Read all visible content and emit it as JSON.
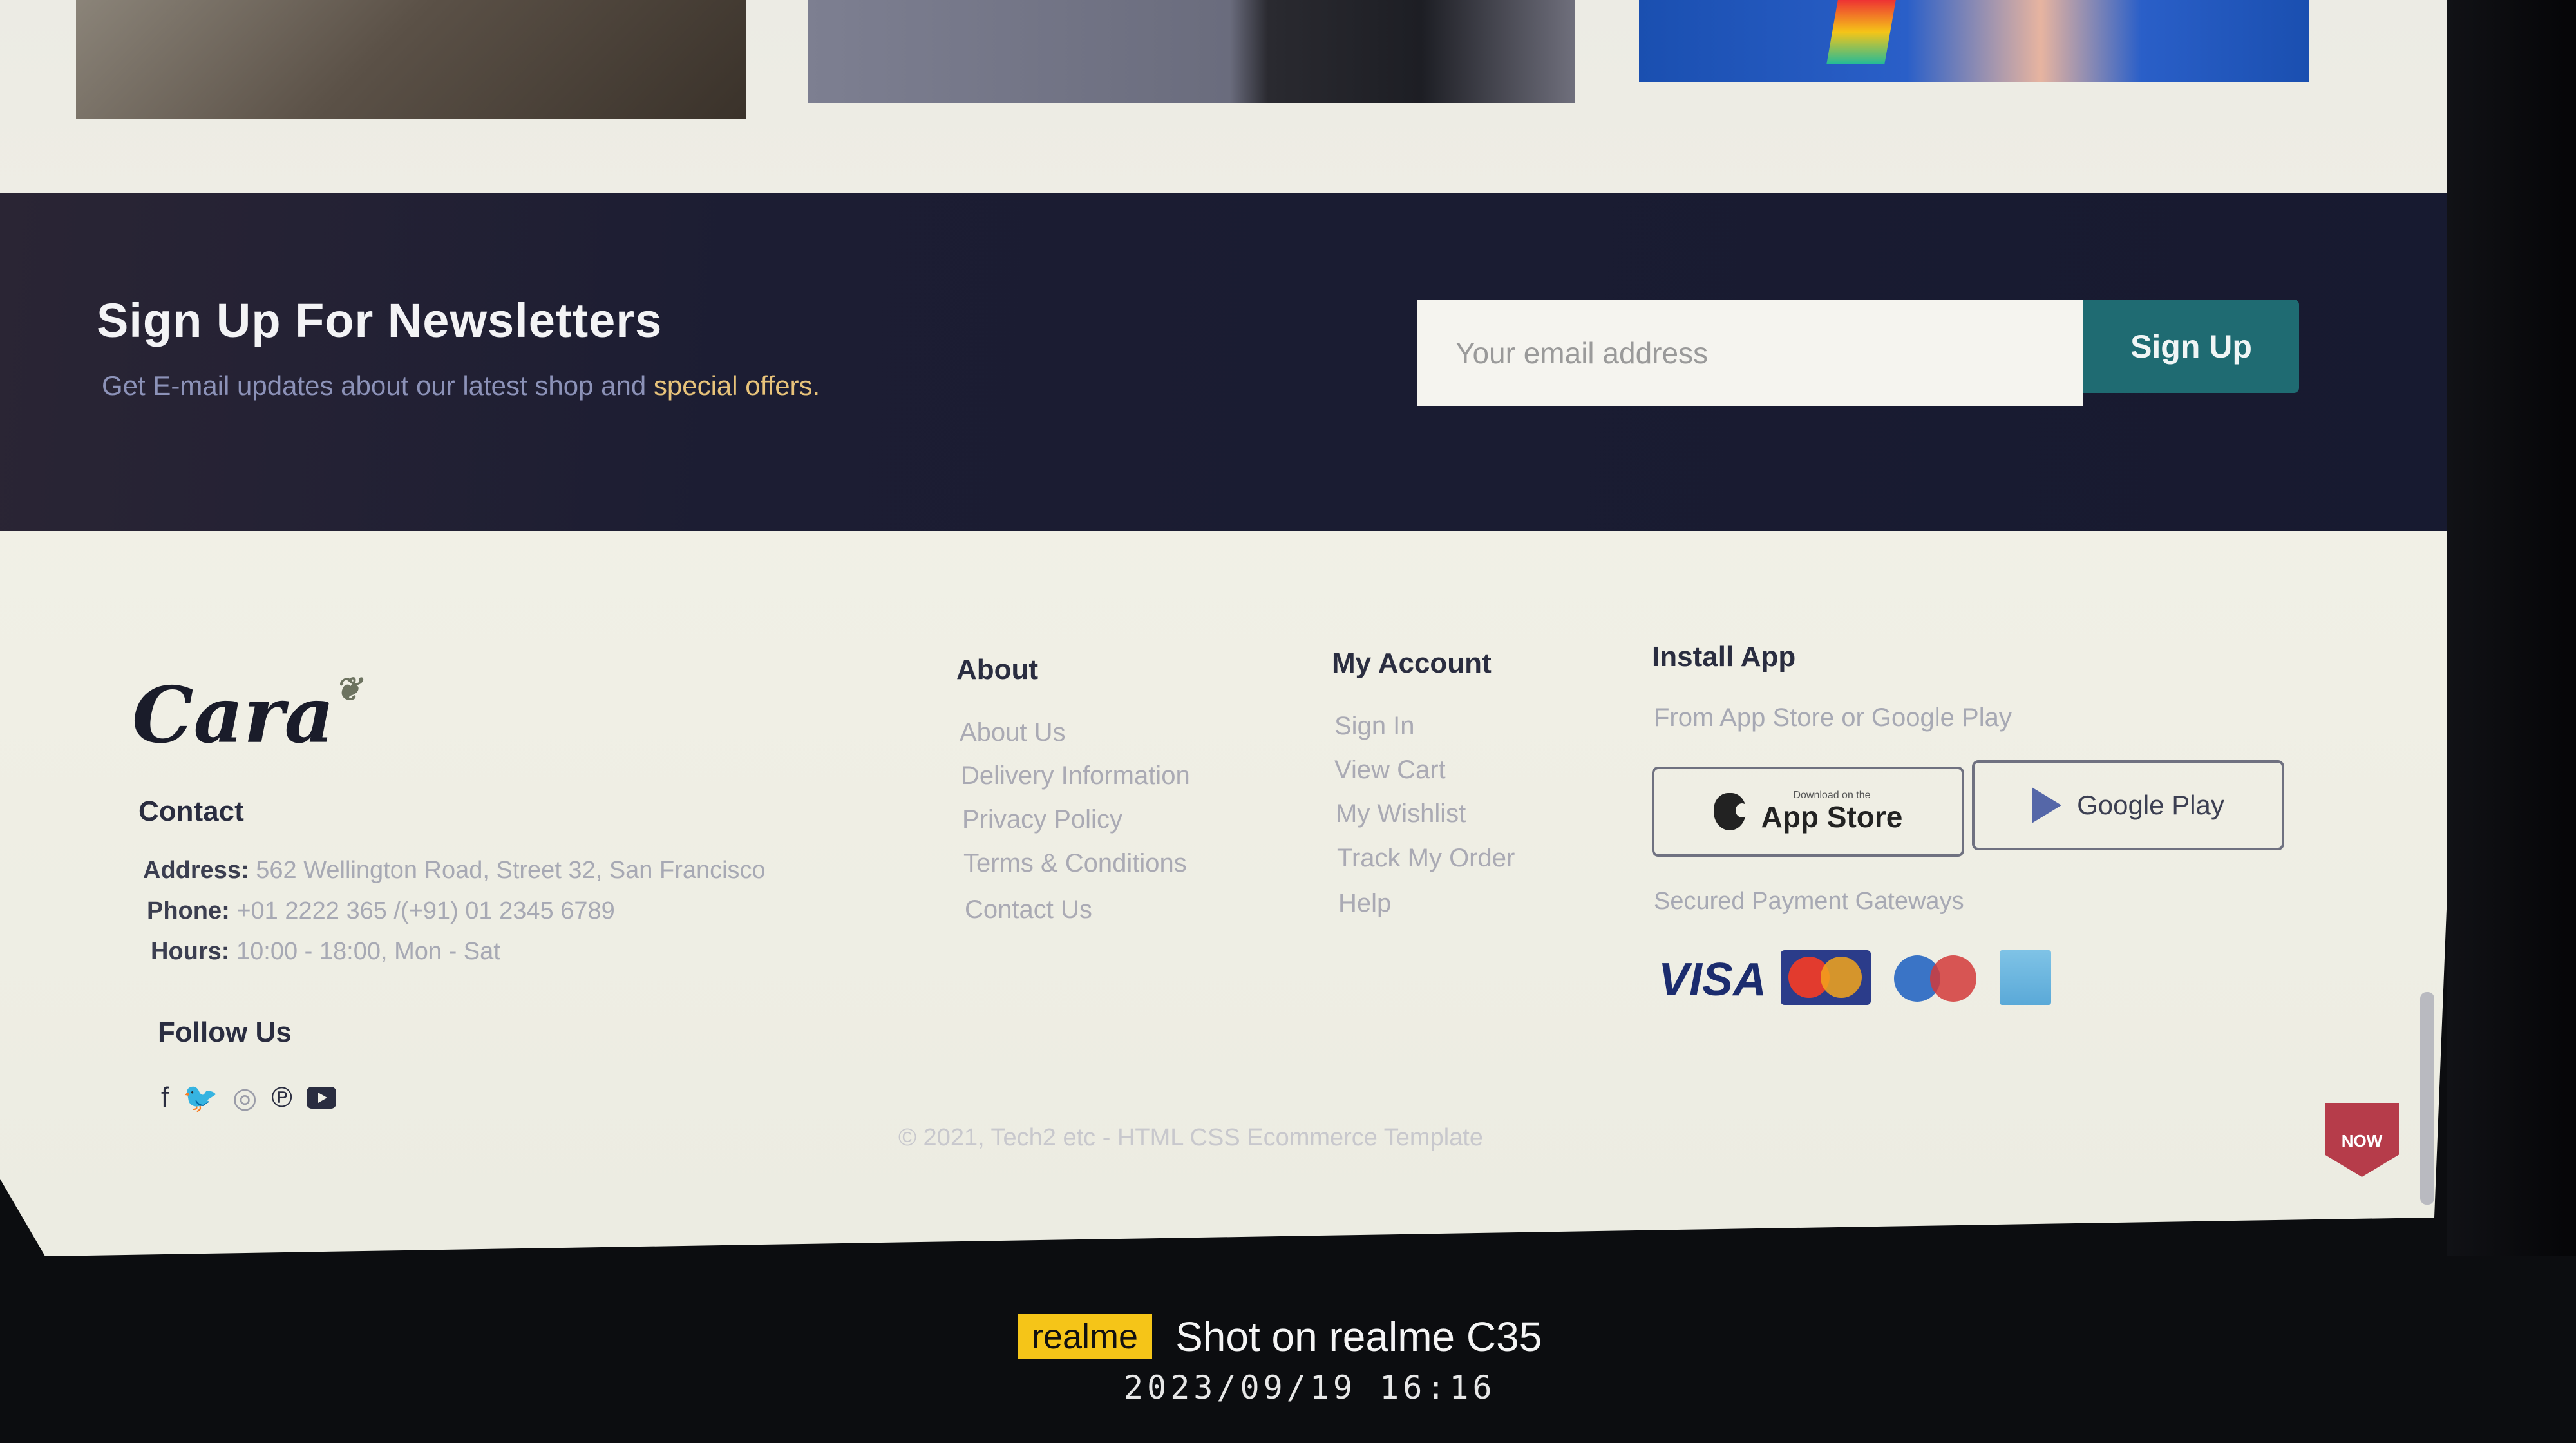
{
  "newsletter": {
    "title": "Sign Up For Newsletters",
    "subtitle_before": "Get E-mail updates about our latest shop and ",
    "subtitle_highlight": "special offers.",
    "email_placeholder": "Your email address",
    "signup_label": "Sign Up"
  },
  "brand": {
    "logo_text": "Cara"
  },
  "contact": {
    "heading": "Contact",
    "address_label": "Address:",
    "address_value": "562 Wellington Road, Street 32, San Francisco",
    "phone_label": "Phone:",
    "phone_value": "+01 2222 365 /(+91) 01 2345 6789",
    "hours_label": "Hours:",
    "hours_value": "10:00 - 18:00, Mon - Sat",
    "follow_heading": "Follow Us",
    "social_icons": [
      "facebook-icon",
      "twitter-icon",
      "instagram-icon",
      "pinterest-icon",
      "youtube-icon"
    ]
  },
  "about": {
    "heading": "About",
    "links": [
      "About Us",
      "Delivery Information",
      "Privacy Policy",
      "Terms & Conditions",
      "Contact Us"
    ]
  },
  "account": {
    "heading": "My Account",
    "links": [
      "Sign In",
      "View Cart",
      "My Wishlist",
      "Track My Order",
      "Help"
    ]
  },
  "install": {
    "heading": "Install App",
    "subtitle": "From App Store or Google Play",
    "appstore_small": "Download on the",
    "appstore_big": "App Store",
    "googleplay": "Google Play",
    "payments_heading": "Secured Payment Gateways",
    "visa": "VISA"
  },
  "copyright": "© 2021, Tech2 etc - HTML CSS Ecommerce Template",
  "badge": "NOW",
  "watermark": {
    "brand": "realme",
    "shot": "Shot on realme C35",
    "datetime": "2023/09/19  16:16"
  },
  "colors": {
    "newsletter_bg": "#1c1d33",
    "signup_button": "#1f6b72",
    "highlight": "#e8c37a",
    "badge": "#b63c4a",
    "watermark_yellow": "#f5c518"
  }
}
